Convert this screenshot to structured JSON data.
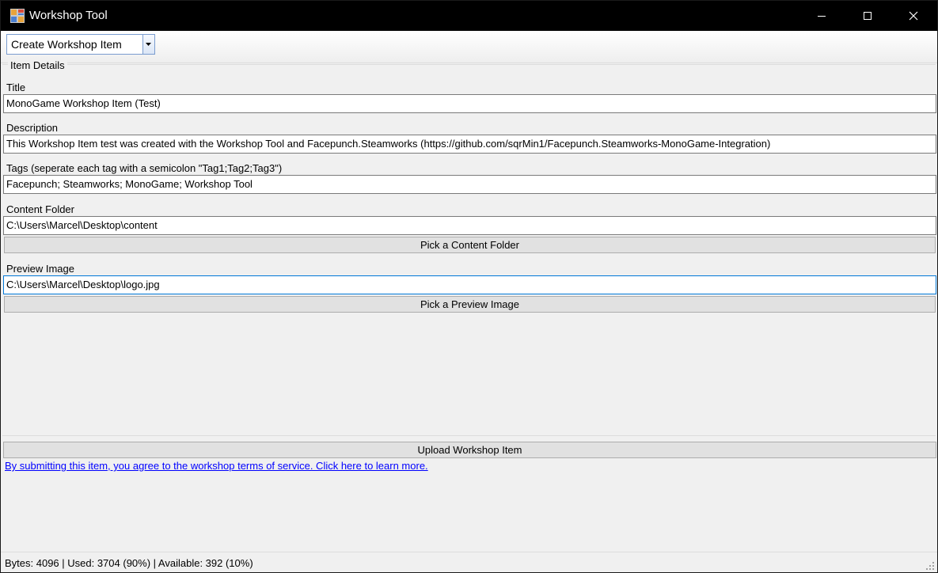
{
  "window": {
    "title": "Workshop Tool"
  },
  "toolbar": {
    "mode_selected": "Create Workshop Item"
  },
  "group": {
    "label": "Item Details"
  },
  "fields": {
    "title": {
      "label": "Title",
      "value": "MonoGame Workshop Item (Test)"
    },
    "description": {
      "label": "Description",
      "value": "This Workshop Item test was created with the Workshop Tool and Facepunch.Steamworks (https://github.com/sqrMin1/Facepunch.Steamworks-MonoGame-Integration)"
    },
    "tags": {
      "label": "Tags (seperate each tag with a semicolon \"Tag1;Tag2;Tag3\")",
      "value": "Facepunch; Steamworks; MonoGame; Workshop Tool"
    },
    "content_folder": {
      "label": "Content Folder",
      "value": "C:\\Users\\Marcel\\Desktop\\content",
      "button_label": "Pick a Content Folder"
    },
    "preview_image": {
      "label": "Preview Image",
      "value": "C:\\Users\\Marcel\\Desktop\\logo.jpg",
      "button_label": "Pick a Preview Image"
    }
  },
  "actions": {
    "upload_label": "Upload Workshop Item",
    "tos_link": "By submitting this item, you agree to the workshop terms of service. Click here to learn more."
  },
  "status": {
    "text": "Bytes: 4096 | Used: 3704 (90%) | Available: 392 (10%)"
  },
  "colors": {
    "titlebar": "#000000",
    "link": "#0000ff",
    "focus_border": "#0078d7"
  }
}
